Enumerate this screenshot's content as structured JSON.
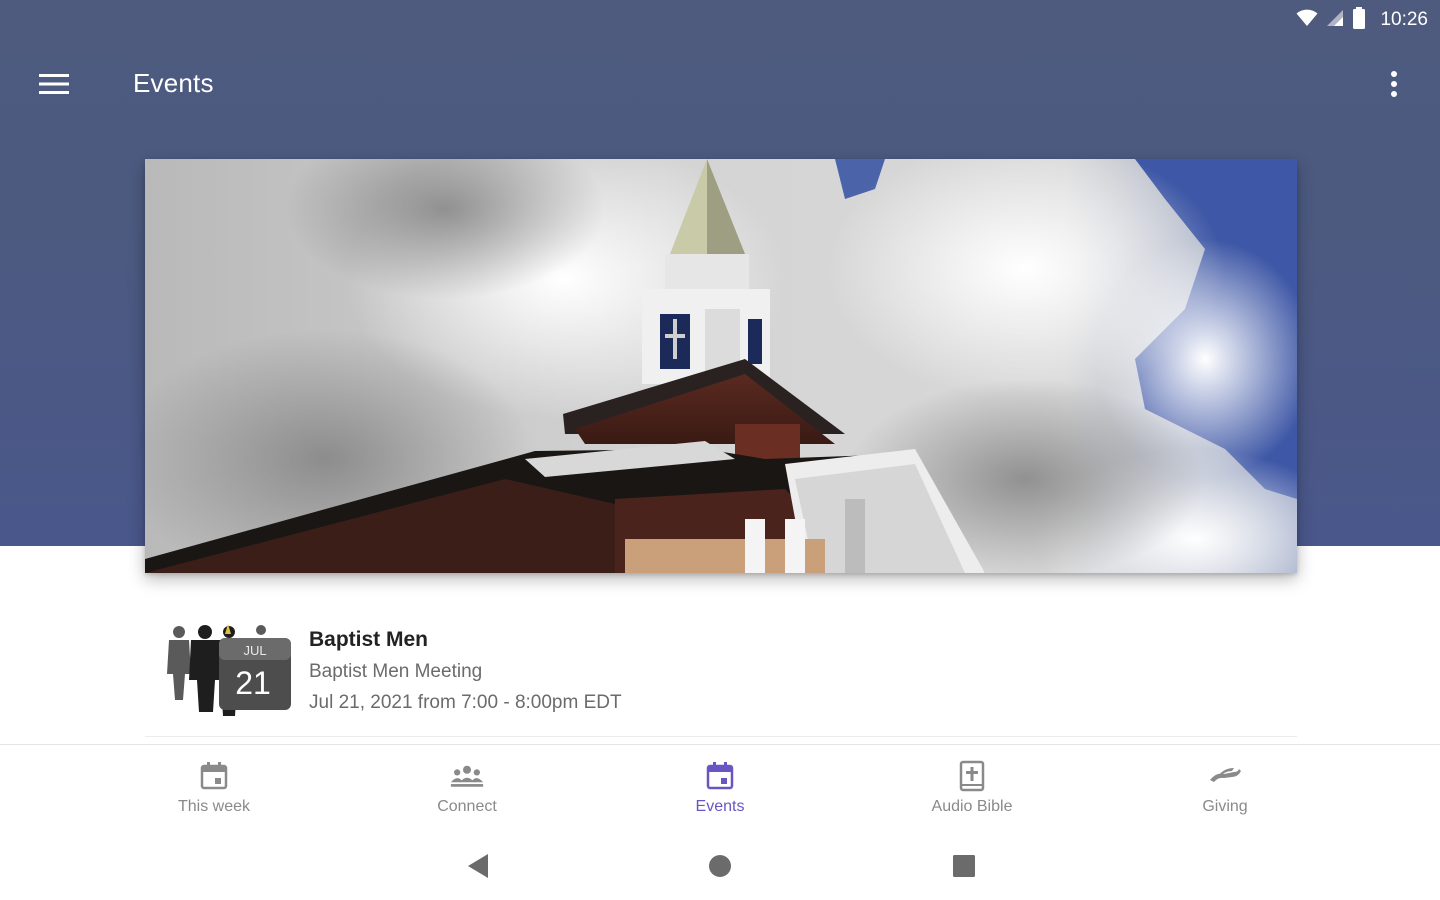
{
  "status_bar": {
    "time": "10:26",
    "icons": [
      "wifi-icon",
      "cellular-signal-icon",
      "battery-icon"
    ]
  },
  "app_bar": {
    "title": "Events",
    "menu_icon": "hamburger-menu-icon",
    "overflow_icon": "more-vert-icon"
  },
  "hero": {
    "description_icon": "church-steeple-photo"
  },
  "events": [
    {
      "title": "Baptist Men",
      "subtitle": "Baptist Men Meeting",
      "datetime": "Jul 21, 2021 from 7:00 - 8:00pm EDT",
      "badge_month": "JUL",
      "badge_day": "21"
    }
  ],
  "bottom_nav": {
    "items": [
      {
        "label": "This week",
        "icon": "calendar-today-icon",
        "active": false
      },
      {
        "label": "Connect",
        "icon": "groups-icon",
        "active": false
      },
      {
        "label": "Events",
        "icon": "calendar-event-icon",
        "active": true
      },
      {
        "label": "Audio Bible",
        "icon": "bible-icon",
        "active": false
      },
      {
        "label": "Giving",
        "icon": "giving-hand-icon",
        "active": false
      }
    ]
  },
  "system_nav": {
    "icons": [
      "back-icon",
      "home-icon",
      "recents-icon"
    ]
  },
  "colors": {
    "header": "#4c5a80",
    "accent": "#6a56c2",
    "inactive": "#8a8a8a"
  }
}
